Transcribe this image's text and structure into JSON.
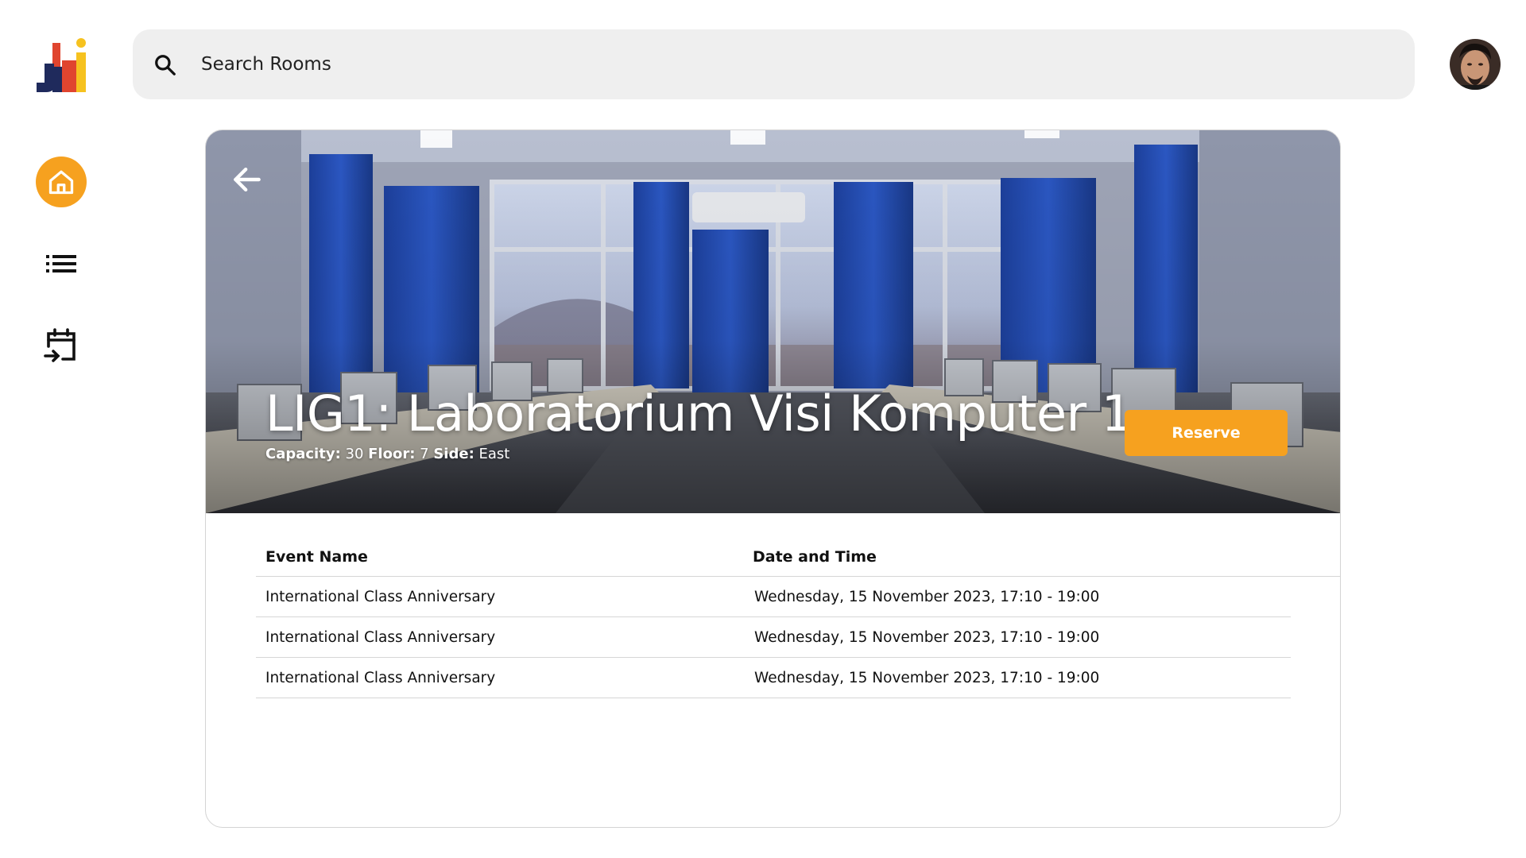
{
  "search": {
    "placeholder": "Search Rooms"
  },
  "room": {
    "title": "LIG1: Laboratorium Visi Komputer 1",
    "capacity_label": "Capacity:",
    "capacity": "30",
    "floor_label": "Floor:",
    "floor": "7",
    "side_label": "Side:",
    "side": "East",
    "reserve_label": "Reserve"
  },
  "events": {
    "headers": {
      "name": "Event Name",
      "date": "Date and Time"
    },
    "rows": [
      {
        "name": "International Class Anniversary",
        "date": "Wednesday, 15 November 2023, 17:10 - 19:00"
      },
      {
        "name": "International Class Anniversary",
        "date": "Wednesday, 15 November 2023, 17:10 - 19:00"
      },
      {
        "name": "International Class Anniversary",
        "date": "Wednesday, 15 November 2023, 17:10 - 19:00"
      }
    ]
  },
  "colors": {
    "accent": "#f6a11f",
    "logo_navy": "#1f2a5c",
    "logo_red": "#e0452f",
    "logo_yellow": "#f6c21f"
  },
  "icons": [
    "app-logo",
    "home-icon",
    "list-icon",
    "calendar-import-icon",
    "search-icon",
    "avatar",
    "back-arrow-icon"
  ]
}
